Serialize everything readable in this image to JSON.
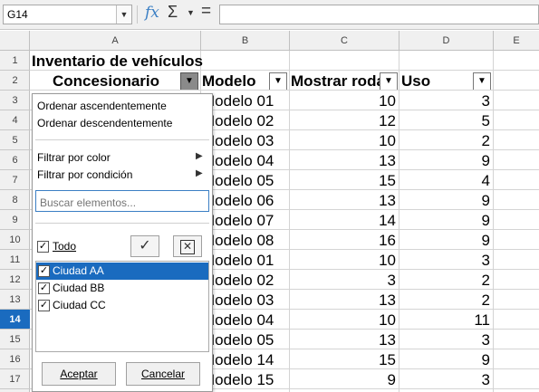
{
  "formula_bar": {
    "name_box": "G14",
    "fx_label": "fx",
    "sigma_label": "Σ",
    "equals_label": "=",
    "formula": ""
  },
  "columns": [
    "A",
    "B",
    "C",
    "D",
    "E"
  ],
  "rows": [
    "1",
    "2",
    "3",
    "4",
    "5",
    "6",
    "7",
    "8",
    "9",
    "10",
    "11",
    "12",
    "13",
    "14",
    "15",
    "16",
    "17"
  ],
  "selected_row": "14",
  "sheet": {
    "title": "Inventario de vehículos",
    "headers": {
      "a": "Concesionario",
      "b": "Modelo",
      "c": "Mostrar rodaje",
      "d": "Uso"
    },
    "data": [
      {
        "model": "Modelo 01",
        "c": "10",
        "d": "3"
      },
      {
        "model": "Modelo 02",
        "c": "12",
        "d": "5"
      },
      {
        "model": "Modelo 03",
        "c": "10",
        "d": "2"
      },
      {
        "model": "Modelo 04",
        "c": "13",
        "d": "9"
      },
      {
        "model": "Modelo 05",
        "c": "15",
        "d": "4"
      },
      {
        "model": "Modelo 06",
        "c": "13",
        "d": "9"
      },
      {
        "model": "Modelo 07",
        "c": "14",
        "d": "9"
      },
      {
        "model": "Modelo 08",
        "c": "16",
        "d": "9"
      },
      {
        "model": "Modelo 01",
        "c": "10",
        "d": "3"
      },
      {
        "model": "Modelo 02",
        "c": "3",
        "d": "2"
      },
      {
        "model": "Modelo 03",
        "c": "13",
        "d": "2"
      },
      {
        "model": "Modelo 04",
        "c": "10",
        "d": "11"
      },
      {
        "model": "Modelo 05",
        "c": "13",
        "d": "3"
      },
      {
        "model": "Modelo 14",
        "c": "15",
        "d": "9"
      },
      {
        "model": "Modelo 15",
        "c": "9",
        "d": "3"
      }
    ]
  },
  "autofilter_popup": {
    "sort_asc": "Ordenar ascendentemente",
    "sort_desc": "Ordenar descendentemente",
    "filter_color": "Filtrar por color",
    "filter_condition": "Filtrar por condición",
    "search_placeholder": "Buscar elementos...",
    "all_label": "Todo",
    "items": [
      {
        "label": "Ciudad AA",
        "checked": true,
        "selected": true
      },
      {
        "label": "Ciudad BB",
        "checked": true,
        "selected": false
      },
      {
        "label": "Ciudad CC",
        "checked": true,
        "selected": false
      }
    ],
    "ok_label": "Aceptar",
    "cancel_label": "Cancelar"
  },
  "colors": {
    "accent": "#1a6bbf",
    "fx": "#3b7fc4"
  }
}
